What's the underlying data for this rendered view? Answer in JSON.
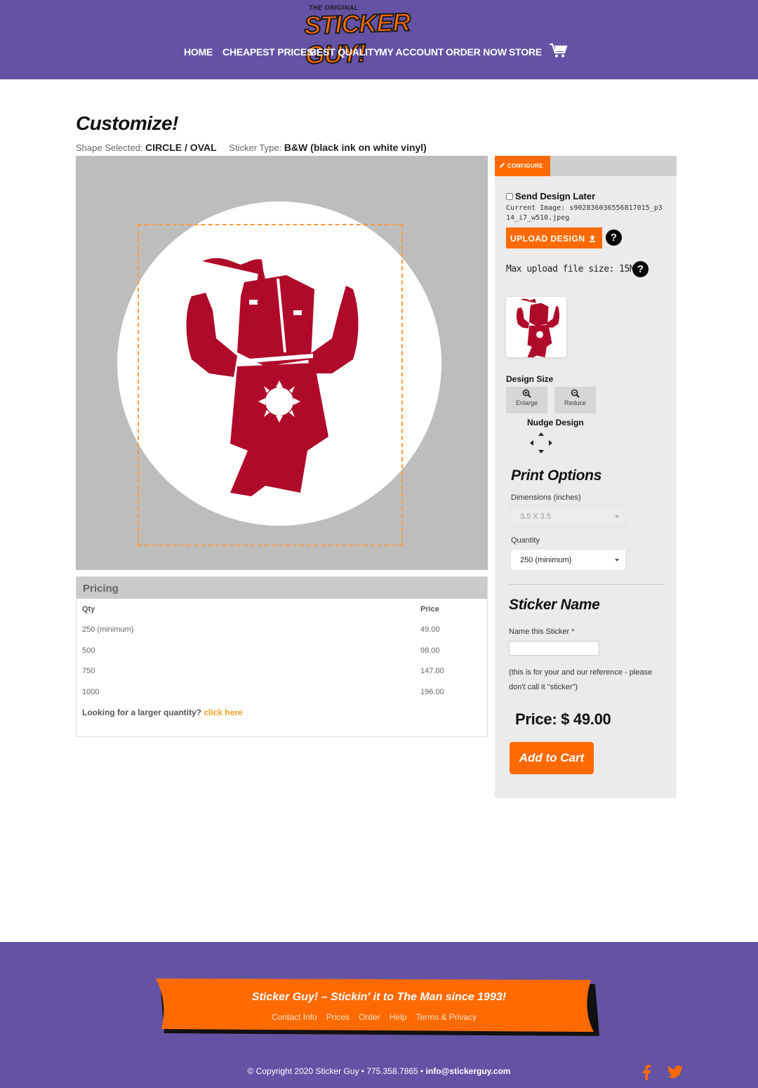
{
  "header": {
    "logo_small": "THE ORIGINAL",
    "logo_big": "STICKER GUY!",
    "nav": [
      "HOME",
      "CHEAPEST PRICES",
      "BEST QUALITY",
      "MY ACCOUNT",
      "ORDER NOW",
      "STORE"
    ]
  },
  "page": {
    "title": "Customize!",
    "shape_label": "Shape Selected:",
    "shape_value": "CIRCLE / OVAL",
    "type_label": "Sticker Type:",
    "type_value": "B&W (black ink on white vinyl)"
  },
  "pricing": {
    "title": "Pricing",
    "col_qty": "Qty",
    "col_price": "Price",
    "rows": [
      {
        "qty": "250 (minimum)",
        "price": "49.00"
      },
      {
        "qty": "500",
        "price": "98.00"
      },
      {
        "qty": "750",
        "price": "147.00"
      },
      {
        "qty": "1000",
        "price": "196.00"
      }
    ],
    "larger_text": "Looking for a larger quantity?",
    "larger_link": "click here"
  },
  "configure": {
    "tab_label": "CONFIGURE",
    "send_later": "Send Design Later",
    "current_image": "Current Image: s902836036556817015_p314_i7_w510.jpeg",
    "upload_button": "UPLOAD DESIGN",
    "max_upload": "Max upload file size: 15MB",
    "design_size": "Design Size",
    "enlarge": "Enlarge",
    "reduce": "Reduce",
    "nudge": "Nudge Design",
    "print_options": "Print Options",
    "dimensions_label": "Dimensions (inches)",
    "dimensions_value": "3.5 X 3.5",
    "quantity_label": "Quantity",
    "quantity_value": "250 (minimum)",
    "sticker_name_title": "Sticker Name",
    "name_label": "Name this Sticker *",
    "name_value": "",
    "name_note": "(this is for your and our reference - please don't call it \"sticker\")",
    "price": "Price: $ 49.00",
    "add_to_cart": "Add to Cart"
  },
  "footer": {
    "tagline": "Sticker Guy! – Stickin' it to The Man since 1993!",
    "links": [
      "Contact Info",
      "Prices",
      "Order",
      "Help",
      "Terms & Privacy"
    ],
    "copyright": "© Copyright 2020 Sticker Guy • 775.358.7865 •",
    "email": "info@stickerguy.com"
  },
  "colors": {
    "brand_purple": "#6453a4",
    "accent_orange": "#ff6a00",
    "design_red": "#b00a2a"
  },
  "icons": [
    "cart-icon",
    "pencil-icon",
    "upload-icon",
    "help-icon",
    "zoom-in-icon",
    "zoom-out-icon",
    "nudge-arrows-icon",
    "facebook-icon",
    "twitter-icon"
  ]
}
